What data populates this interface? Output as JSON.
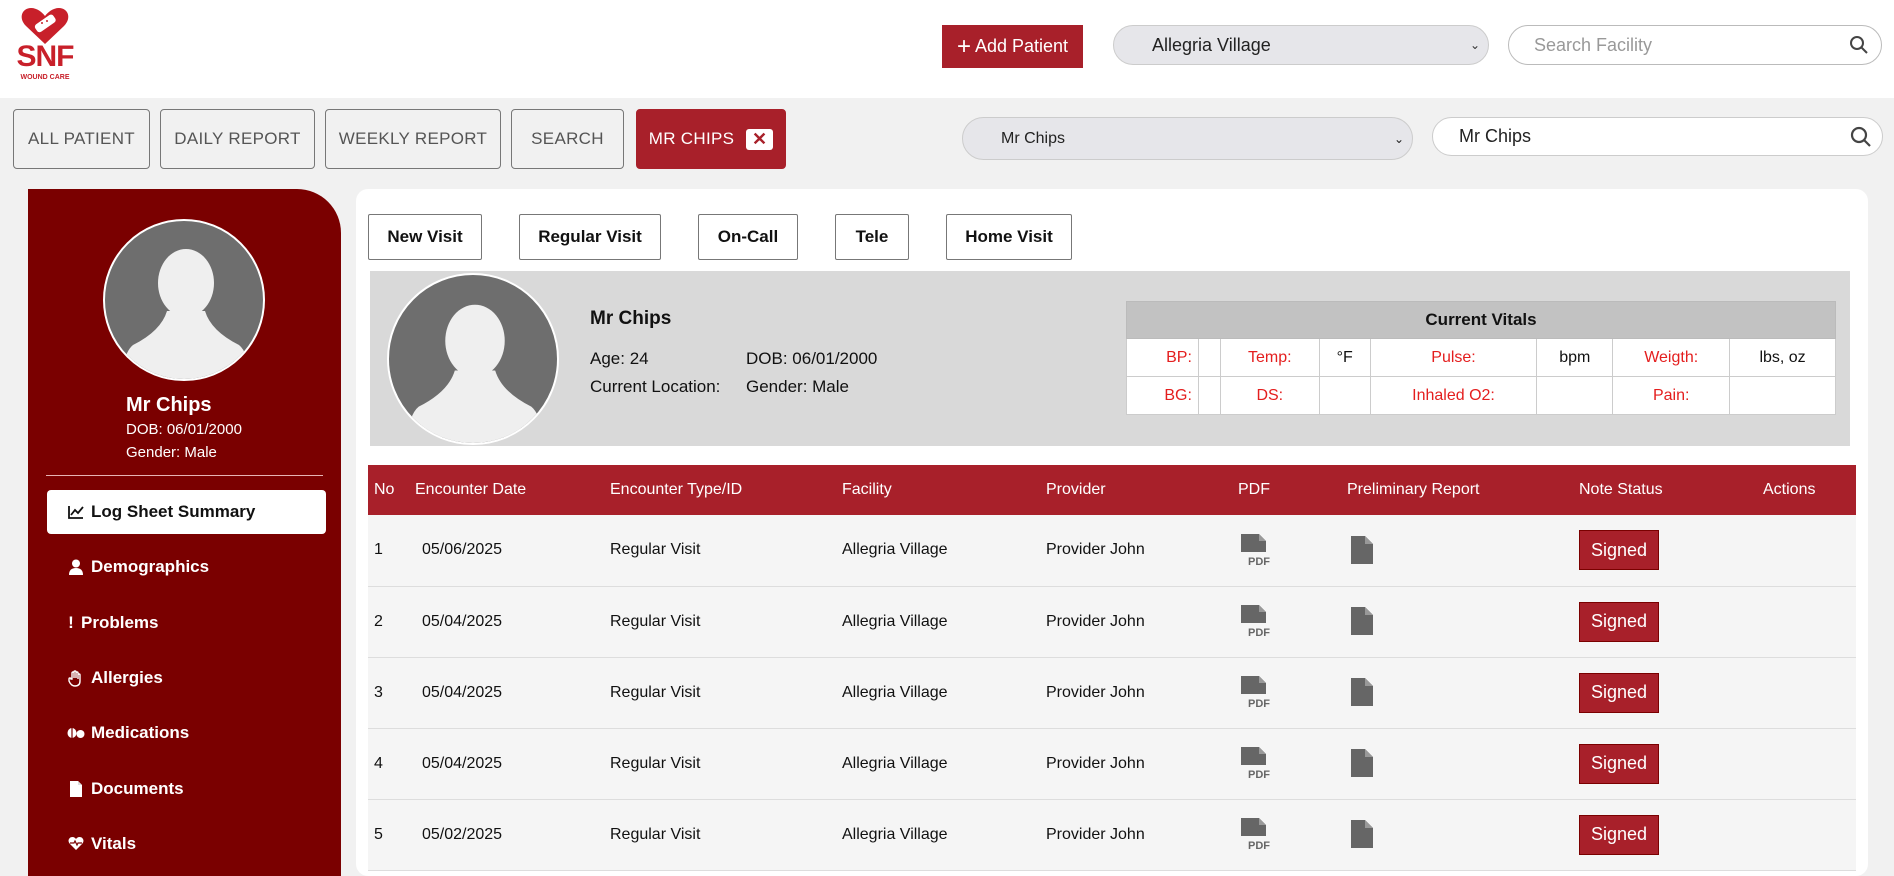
{
  "header": {
    "logo_text": "SNF",
    "logo_sub": "WOUND CARE",
    "add_patient_label": "Add Patient",
    "facility_select": "Allegria Village",
    "facility_search_placeholder": "Search Facility"
  },
  "tabs": [
    {
      "label": "ALL PATIENT"
    },
    {
      "label": "DAILY REPORT"
    },
    {
      "label": "WEEKLY REPORT"
    },
    {
      "label": "SEARCH"
    },
    {
      "label": "MR CHIPS"
    }
  ],
  "patient_select": "Mr Chips",
  "patient_search_value": "Mr Chips",
  "sidebar": {
    "name": "Mr Chips",
    "dob": "DOB: 06/01/2000",
    "gender": "Gender: Male",
    "menu": [
      {
        "label": "Log Sheet Summary",
        "icon": "chart-line-icon"
      },
      {
        "label": "Demographics",
        "icon": "user-icon"
      },
      {
        "label": "Problems",
        "icon": "exclamation-icon"
      },
      {
        "label": "Allergies",
        "icon": "hand-icon"
      },
      {
        "label": "Medications",
        "icon": "pills-icon"
      },
      {
        "label": "Documents",
        "icon": "file-icon"
      },
      {
        "label": "Vitals",
        "icon": "heartbeat-icon"
      }
    ]
  },
  "visit_buttons": [
    "New Visit",
    "Regular Visit",
    "On-Call",
    "Tele",
    "Home Visit"
  ],
  "patient_info": {
    "name": "Mr Chips",
    "age": "Age: 24",
    "dob": "DOB: 06/01/2000",
    "location": "Current Location:",
    "gender": "Gender: Male"
  },
  "vitals": {
    "title": "Current Vitals",
    "bp": "BP:",
    "temp": "Temp:",
    "temp_unit": "°F",
    "pulse": "Pulse:",
    "pulse_unit": "bpm",
    "weight": "Weigth:",
    "weight_unit": "lbs, oz",
    "bg": "BG:",
    "ds": "DS:",
    "o2": "Inhaled O2:",
    "pain": "Pain:"
  },
  "table": {
    "headers": [
      "No",
      "Encounter Date",
      "Encounter Type/ID",
      "Facility",
      "Provider",
      "PDF",
      "Preliminary Report",
      "Note Status",
      "Actions"
    ],
    "rows": [
      {
        "no": "1",
        "date": "05/06/2025",
        "type": "Regular Visit",
        "facility": "Allegria Village",
        "provider": "Provider John",
        "status": "Signed"
      },
      {
        "no": "2",
        "date": "05/04/2025",
        "type": "Regular Visit",
        "facility": "Allegria Village",
        "provider": "Provider John",
        "status": "Signed"
      },
      {
        "no": "3",
        "date": "05/04/2025",
        "type": "Regular Visit",
        "facility": "Allegria Village",
        "provider": "Provider John",
        "status": "Signed"
      },
      {
        "no": "4",
        "date": "05/04/2025",
        "type": "Regular Visit",
        "facility": "Allegria Village",
        "provider": "Provider John",
        "status": "Signed"
      },
      {
        "no": "5",
        "date": "05/02/2025",
        "type": "Regular Visit",
        "facility": "Allegria Village",
        "provider": "Provider John",
        "status": "Signed"
      }
    ]
  },
  "colors": {
    "brand": "#a8202a",
    "sidebar": "#7a0000",
    "vital_label": "#e41e1e"
  }
}
